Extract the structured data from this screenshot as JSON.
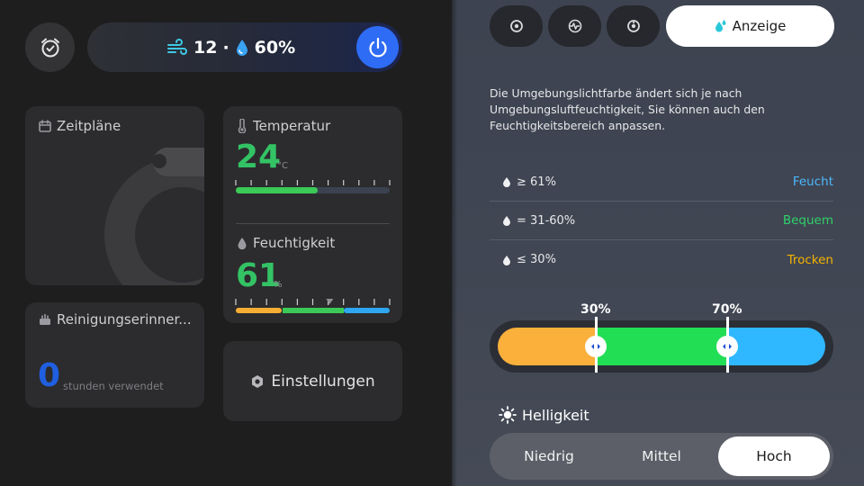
{
  "header": {
    "wind_value": "12",
    "separator": "·",
    "humidity_value": "60%"
  },
  "cards": {
    "schedules": {
      "title": "Zeitpläne"
    },
    "temperature": {
      "title": "Temperatur",
      "value": "24",
      "unit": "°C",
      "level": 0.53
    },
    "humidity": {
      "title": "Feuchtigkeit",
      "value": "61",
      "unit": "%",
      "pointer_level": 0.61
    },
    "cleaning": {
      "title": "Reinigungserinner...",
      "value": "0",
      "unit_text": "stunden verwendet"
    },
    "settings": {
      "label": "Einstellungen"
    }
  },
  "tabs": {
    "active_label": "Anzeige",
    "icons": [
      "eye-icon",
      "pulse-icon",
      "dial-icon"
    ]
  },
  "display": {
    "description": "Die Umgebungslichtfarbe ändert sich je nach Umgebungsluftfeuchtigkeit, Sie können auch den Feuchtigkeitsbereich anpassen.",
    "ranges": [
      {
        "condition": "≥ 61%",
        "label": "Feucht",
        "color": "#4db8ff"
      },
      {
        "condition": "= 31-60%",
        "label": "Bequem",
        "color": "#2fd26a"
      },
      {
        "condition": "≤ 30%",
        "label": "Trocken",
        "color": "#f5b400"
      }
    ],
    "slider": {
      "low_label": "30%",
      "high_label": "70%",
      "low_value": 30,
      "high_value": 70,
      "colors": [
        "#fbb03b",
        "#22de55",
        "#2fb7ff"
      ]
    },
    "brightness": {
      "title": "Helligkeit",
      "options": [
        "Niedrig",
        "Mittel",
        "Hoch"
      ],
      "selected": "Hoch"
    }
  },
  "colors": {
    "accent_blue": "#2e6cf5",
    "value_green": "#33c365",
    "cleaning_blue": "#1f5fe0"
  }
}
